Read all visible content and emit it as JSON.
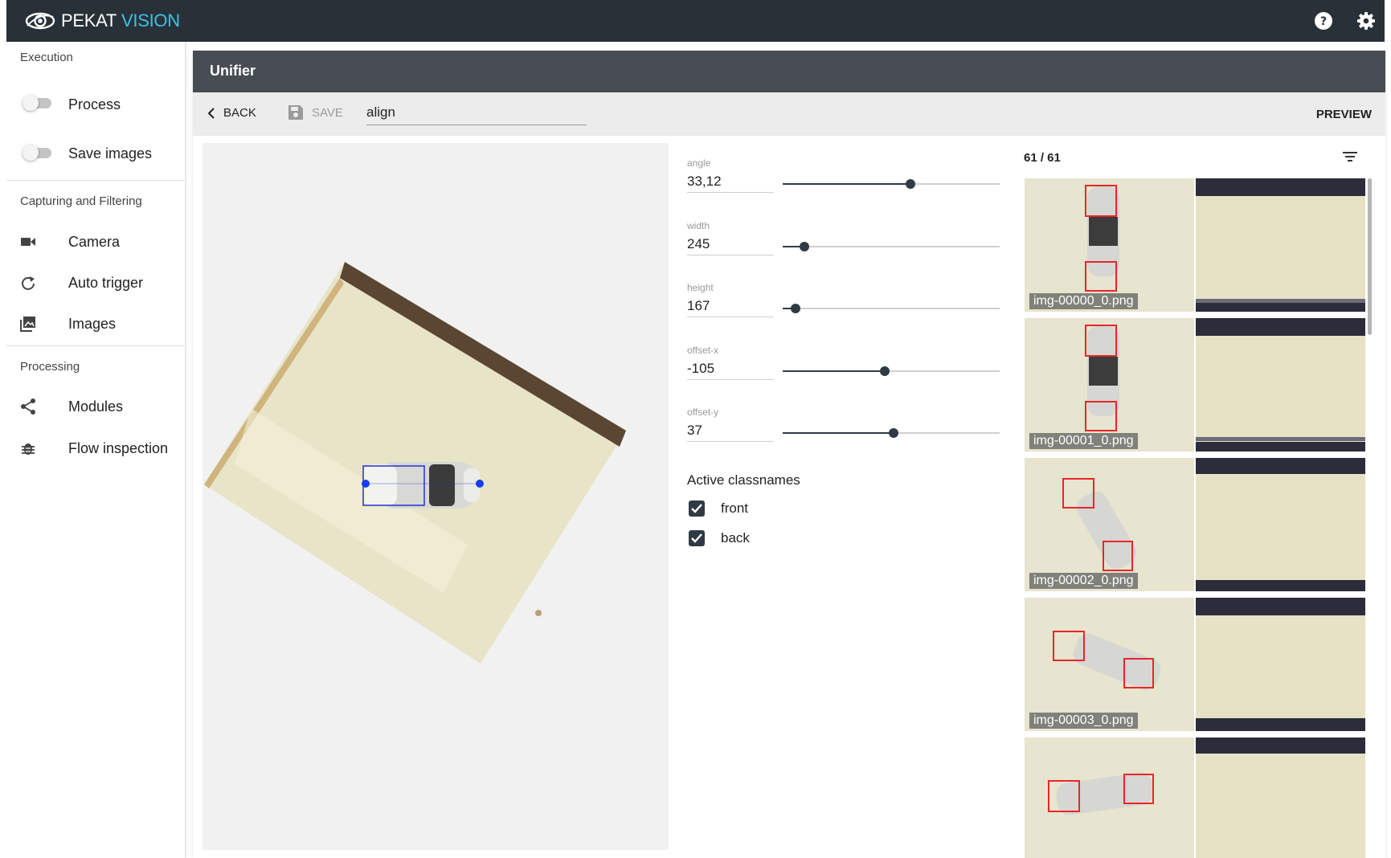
{
  "app": {
    "brand_main": "PEKAT",
    "brand_accent": "VISION"
  },
  "colors": {
    "topbar": "#293138",
    "accent": "#3cc1e8",
    "header": "#474d52",
    "slider": "#2f3a44",
    "box": "#e8262a"
  },
  "sidebar": {
    "execution_title": "Execution",
    "process_label": "Process",
    "process_on": false,
    "save_images_label": "Save images",
    "save_images_on": false,
    "capturing_title": "Capturing and Filtering",
    "camera_label": "Camera",
    "auto_trigger_label": "Auto trigger",
    "images_label": "Images",
    "processing_title": "Processing",
    "modules_label": "Modules",
    "flow_inspection_label": "Flow inspection"
  },
  "header": {
    "title": "Unifier"
  },
  "toolbar": {
    "back_label": "BACK",
    "save_label": "SAVE",
    "name_value": "align",
    "preview_label": "PREVIEW"
  },
  "params": [
    {
      "label": "angle",
      "value": "33,12",
      "fraction": 0.59
    },
    {
      "label": "width",
      "value": "245",
      "fraction": 0.1
    },
    {
      "label": "height",
      "value": "167",
      "fraction": 0.06
    },
    {
      "label": "offset-x",
      "value": "-105",
      "fraction": 0.47
    },
    {
      "label": "offset-y",
      "value": "37",
      "fraction": 0.51
    }
  ],
  "classes": {
    "title": "Active classnames",
    "items": [
      {
        "label": "front",
        "checked": true
      },
      {
        "label": "back",
        "checked": true
      }
    ]
  },
  "gallery": {
    "count": "61 / 61",
    "items": [
      {
        "name": "img-00000_0.png"
      },
      {
        "name": "img-00001_0.png"
      },
      {
        "name": "img-00002_0.png"
      },
      {
        "name": "img-00003_0.png"
      },
      {
        "name": ""
      }
    ]
  }
}
